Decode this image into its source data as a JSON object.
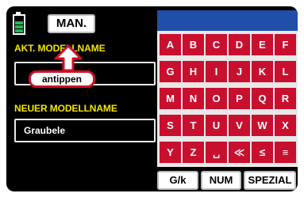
{
  "header": {
    "mode_button": "MAN."
  },
  "current_model": {
    "label": "AKT. MODELLNAME",
    "value": ""
  },
  "callout": {
    "text": "antippen"
  },
  "new_model": {
    "label": "NEUER MODELLNAME",
    "value": "Graubele"
  },
  "keyboard": {
    "keys": [
      [
        "A",
        "B",
        "C",
        "D",
        "E",
        "F"
      ],
      [
        "G",
        "H",
        "I",
        "J",
        "K",
        "L"
      ],
      [
        "M",
        "N",
        "O",
        "P",
        "Q",
        "R"
      ],
      [
        "S",
        "T",
        "U",
        "V",
        "W",
        "X"
      ],
      [
        "Y",
        "Z",
        "␣",
        "≪",
        "≤",
        "≡"
      ]
    ]
  },
  "bottom_buttons": {
    "case": "G/k",
    "num": "NUM",
    "special": "SPEZIAL"
  },
  "colors": {
    "key_red": "#c8102e",
    "header_blue": "#1f4fa8",
    "label_yellow": "#f5e400",
    "battery_green": "#2db35a"
  },
  "battery": {
    "level": 1.0
  }
}
